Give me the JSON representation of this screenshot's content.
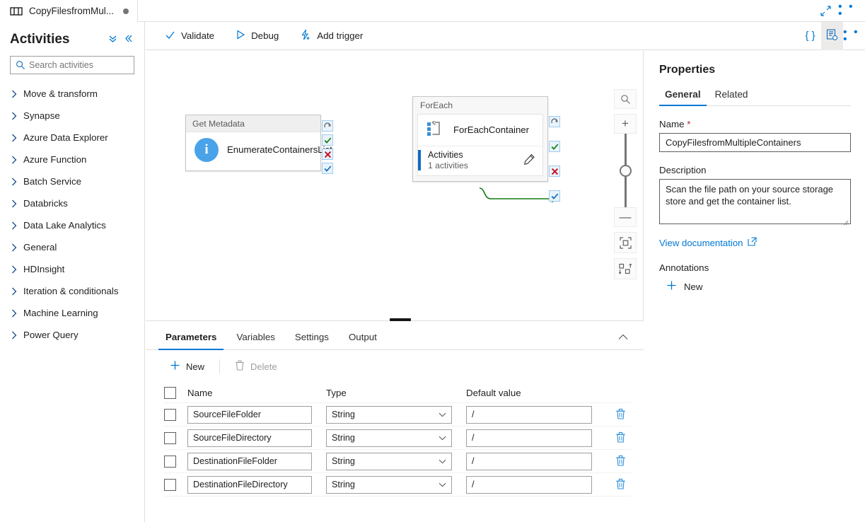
{
  "tabstrip": {
    "tab_icon": "pipeline-icon",
    "tab_title": "CopyFilesfromMul...",
    "unsaved_indicator": "●",
    "expand_icon": "expand-diagonal-icon",
    "more_icon": "• • •"
  },
  "activities": {
    "title": "Activities",
    "collapse_all_icon": "double-chevron-down-icon",
    "collapse_pane_icon": "double-chevron-left-icon",
    "search": {
      "placeholder": "Search activities",
      "value": "",
      "icon": "search-icon"
    },
    "categories": [
      {
        "label": "Move & transform"
      },
      {
        "label": "Synapse"
      },
      {
        "label": "Azure Data Explorer"
      },
      {
        "label": "Azure Function"
      },
      {
        "label": "Batch Service"
      },
      {
        "label": "Databricks"
      },
      {
        "label": "Data Lake Analytics"
      },
      {
        "label": "General"
      },
      {
        "label": "HDInsight"
      },
      {
        "label": "Iteration & conditionals"
      },
      {
        "label": "Machine Learning"
      },
      {
        "label": "Power Query"
      }
    ]
  },
  "commandbar": {
    "validate": "Validate",
    "debug": "Debug",
    "add_trigger": "Add trigger",
    "code_icon": "{ }",
    "properties_icon": "properties-panel-icon",
    "more_icon": "• • •"
  },
  "canvas": {
    "get_metadata": {
      "type_label": "Get Metadata",
      "name": "EnumerateContainersList",
      "icon": "info-circle-icon",
      "status_chips": [
        "skip-icon",
        "success-check-icon",
        "failure-x-icon",
        "completion-check-icon"
      ]
    },
    "foreach": {
      "type_label": "ForEach",
      "name": "ForEachContainer",
      "icon": "foreach-loop-icon",
      "activities_label": "Activities",
      "activities_count": "1 activities",
      "edit_icon": "pencil-icon",
      "status_chips": [
        "skip-icon",
        "success-check-icon",
        "failure-x-icon",
        "completion-check-icon"
      ]
    },
    "zoom_controls": {
      "search_icon": "magnifier-icon",
      "zoom_in": "+",
      "zoom_out": "—",
      "fit_icon": "fit-to-screen-icon",
      "autolayout_icon": "auto-align-icon"
    }
  },
  "bottom": {
    "tabs": [
      {
        "label": "Parameters",
        "active": true
      },
      {
        "label": "Variables",
        "active": false
      },
      {
        "label": "Settings",
        "active": false
      },
      {
        "label": "Output",
        "active": false
      }
    ],
    "collapse_icon": "chevron-up-icon",
    "new_label": "New",
    "delete_label": "Delete",
    "columns": [
      "Name",
      "Type",
      "Default value"
    ],
    "rows": [
      {
        "name": "SourceFileFolder",
        "type": "String",
        "default": "/"
      },
      {
        "name": "SourceFileDirectory",
        "type": "String",
        "default": "/"
      },
      {
        "name": "DestinationFileFolder",
        "type": "String",
        "default": "/"
      },
      {
        "name": "DestinationFileDirectory",
        "type": "String",
        "default": "/"
      }
    ],
    "delete_row_icon": "trash-icon"
  },
  "properties": {
    "title": "Properties",
    "tabs": [
      {
        "label": "General",
        "active": true
      },
      {
        "label": "Related",
        "active": false
      }
    ],
    "name_label": "Name",
    "name_required": "*",
    "name_value": "CopyFilesfromMultipleContainers",
    "description_label": "Description",
    "description_value": "Scan the file path on your source storage store and get the container list.",
    "doc_link": "View documentation",
    "doc_link_icon": "external-link-icon",
    "annotations_label": "Annotations",
    "annotation_new": "New",
    "annotation_new_icon": "plus-icon"
  },
  "colors": {
    "accent": "#0078d4",
    "success": "#107c10",
    "failure": "#c50f1f",
    "connector": "#107c10",
    "node_icon_blue": "#4aa3e8",
    "foreach_bar": "#0f6cbd"
  }
}
